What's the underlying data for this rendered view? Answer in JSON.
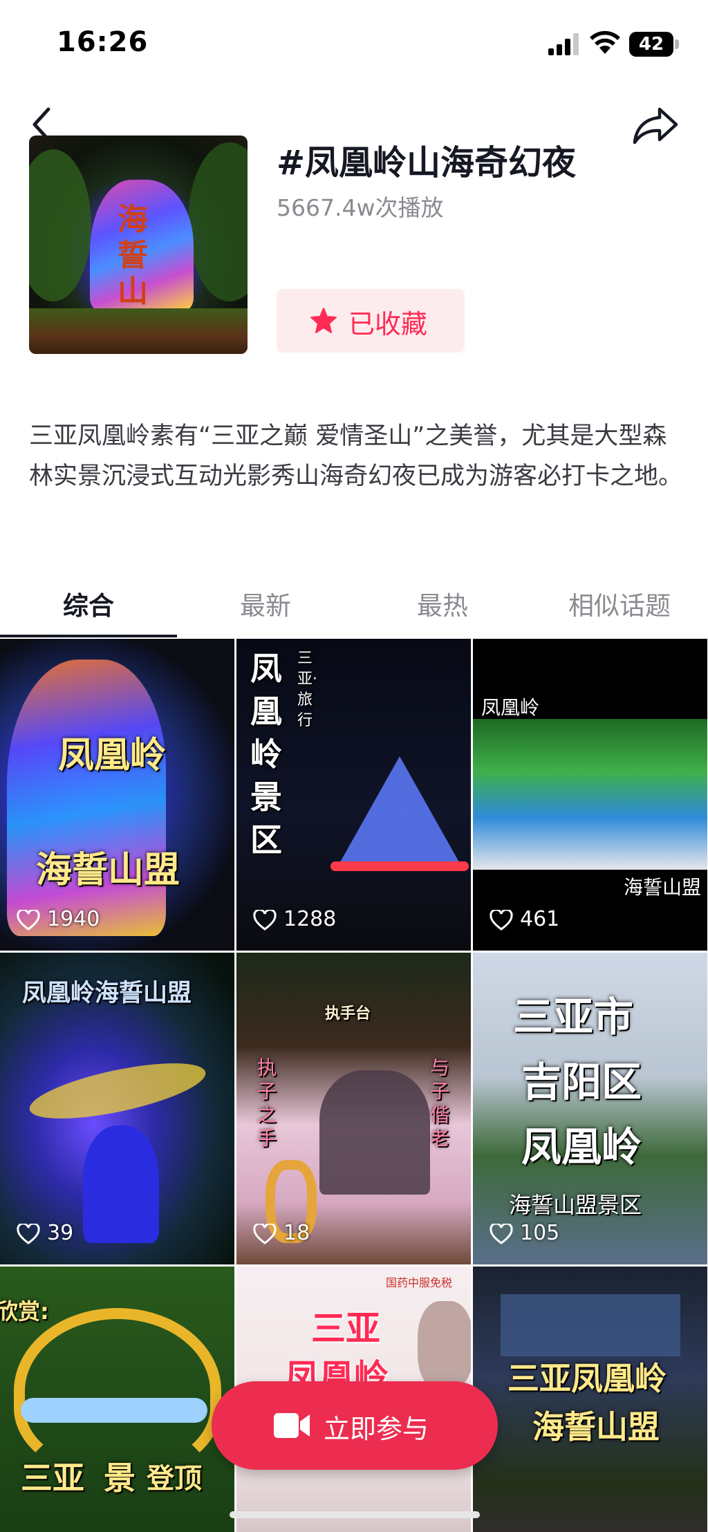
{
  "status_bar": {
    "time": "16:26",
    "battery": "42"
  },
  "topic": {
    "title": "#凤凰岭山海奇幻夜",
    "plays": "5667.4w次播放",
    "cover_text": "海誓山盟",
    "favorite_label": "已收藏",
    "description": "三亚凤凰岭素有“三亚之巅 爱情圣山”之美誉，尤其是大型森林实景沉浸式互动光影秀山海奇幻夜已成为游客必打卡之地。"
  },
  "tabs": [
    {
      "label": "综合"
    },
    {
      "label": "最新"
    },
    {
      "label": "最热"
    },
    {
      "label": "相似话题"
    }
  ],
  "videos": [
    {
      "text": [
        "凤凰岭",
        "海誓山盟"
      ],
      "likes": "1940"
    },
    {
      "text": [
        "凤凰岭景区",
        "三亚·旅行"
      ],
      "likes": "1288"
    },
    {
      "text": [
        "凤凰岭",
        "海誓山盟"
      ],
      "likes": "461"
    },
    {
      "text": [
        "凤凰岭海誓山盟"
      ],
      "likes": "39"
    },
    {
      "text": [
        "执子之手",
        "与子偕老",
        "执手台"
      ],
      "likes": "18"
    },
    {
      "text": [
        "三亚市",
        "吉阳区",
        "凤凰岭",
        "海誓山盟景区"
      ],
      "likes": "105"
    },
    {
      "text": [
        "欣赏:",
        "三亚",
        "景",
        "登顶"
      ]
    },
    {
      "text": [
        "三亚",
        "凤凰岭",
        "国药中服免税"
      ]
    },
    {
      "text": [
        "三亚凤凰岭",
        "海誓山盟"
      ]
    }
  ],
  "join_button": {
    "label": "立即参与"
  },
  "colors": {
    "accent": "#fe2c55",
    "join_bg": "#ec2d4f"
  },
  "icons": [
    "back-icon",
    "share-icon",
    "star-icon",
    "heart-icon",
    "video-camera-icon"
  ]
}
